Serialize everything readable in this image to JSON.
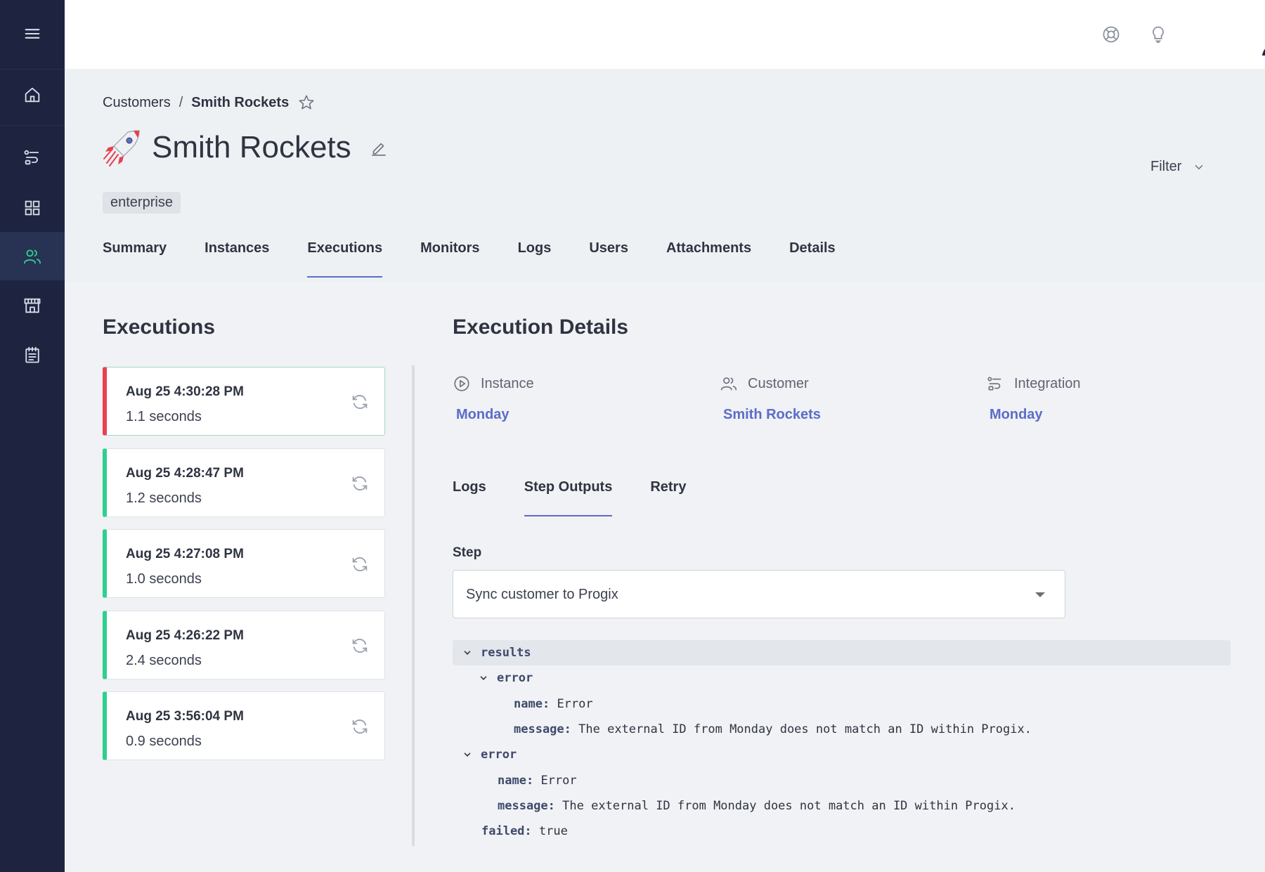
{
  "topbar": {
    "icons": [
      "support-icon",
      "lightbulb-icon"
    ],
    "avatar": "user-avatar"
  },
  "sidebar": {
    "items": [
      {
        "icon": "menu-icon"
      },
      {
        "icon": "home-icon"
      },
      {
        "icon": "integrations-icon"
      },
      {
        "icon": "components-icon"
      },
      {
        "icon": "customers-icon",
        "active": true
      },
      {
        "icon": "marketplace-icon"
      },
      {
        "icon": "logs-icon"
      }
    ],
    "accent": "#2ecf8f"
  },
  "breadcrumb": {
    "parent": "Customers",
    "separator": "/",
    "current": "Smith Rockets"
  },
  "customer": {
    "name": "Smith Rockets",
    "tag": "enterprise"
  },
  "filter": {
    "label": "Filter"
  },
  "tabs": [
    "Summary",
    "Instances",
    "Executions",
    "Monitors",
    "Logs",
    "Users",
    "Attachments",
    "Details"
  ],
  "active_tab": "Executions",
  "executions": {
    "title": "Executions",
    "items": [
      {
        "timestamp": "Aug 25 4:30:28 PM",
        "duration": "1.1 seconds",
        "status": "failed"
      },
      {
        "timestamp": "Aug 25 4:28:47 PM",
        "duration": "1.2 seconds",
        "status": "success"
      },
      {
        "timestamp": "Aug 25 4:27:08 PM",
        "duration": "1.0 seconds",
        "status": "success"
      },
      {
        "timestamp": "Aug 25 4:26:22 PM",
        "duration": "2.4 seconds",
        "status": "success"
      },
      {
        "timestamp": "Aug 25 3:56:04 PM",
        "duration": "0.9 seconds",
        "status": "success"
      }
    ]
  },
  "details": {
    "title": "Execution Details",
    "meta": [
      {
        "label": "Instance",
        "value": "Monday",
        "icon": "play-circle-icon"
      },
      {
        "label": "Customer",
        "value": "Smith Rockets",
        "icon": "users-icon"
      },
      {
        "label": "Integration",
        "value": "Monday",
        "icon": "integration-icon"
      }
    ],
    "subtabs": [
      "Logs",
      "Step Outputs",
      "Retry"
    ],
    "active_subtab": "Step Outputs",
    "step_label": "Step",
    "step_value": "Sync customer to Progix",
    "tree": {
      "results_key": "results",
      "inner_error_key": "error",
      "inner_name_key": "name:",
      "inner_name_val": "Error",
      "inner_message_key": "message:",
      "inner_message_val": "The external ID from Monday does not match an ID within Progix.",
      "error_key": "error",
      "name_key": "name:",
      "name_val": "Error",
      "message_key": "message:",
      "message_val": "The external ID from Monday does not match an ID within Progix.",
      "failed_key": "failed:",
      "failed_val": "true"
    }
  },
  "colors": {
    "sidebar_bg": "#1e2440",
    "link": "#5b6cc9",
    "success": "#2ecf8f",
    "failure": "#e8404f"
  }
}
